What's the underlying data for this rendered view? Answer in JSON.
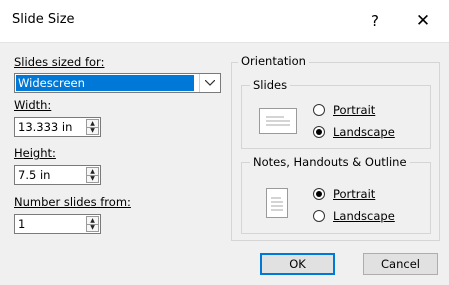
{
  "dialog": {
    "title": "Slide Size",
    "help_glyph": "?",
    "close_glyph": "✕"
  },
  "left": {
    "slides_sized_for_label": "Slides sized for:",
    "slides_sized_for_value": "Widescreen",
    "width_label": "Width:",
    "width_value": "13.333 in",
    "height_label": "Height:",
    "height_value": "7.5 in",
    "number_from_label": "Number slides from:",
    "number_from_value": "1"
  },
  "orientation": {
    "title": "Orientation",
    "slides": {
      "title": "Slides",
      "portrait_label": "Portrait",
      "landscape_label": "Landscape",
      "selected": "landscape"
    },
    "notes": {
      "title": "Notes, Handouts & Outline",
      "portrait_label": "Portrait",
      "landscape_label": "Landscape",
      "selected": "portrait"
    }
  },
  "buttons": {
    "ok": "OK",
    "cancel": "Cancel"
  },
  "icons": {
    "combo_arrow": "chevron-down-icon",
    "spin": "spin-arrows-icon",
    "slides_page": "landscape-page-icon",
    "notes_page": "portrait-page-icon"
  },
  "colors": {
    "selection": "#0078d7",
    "dialog_bg": "#f0f0f0"
  }
}
